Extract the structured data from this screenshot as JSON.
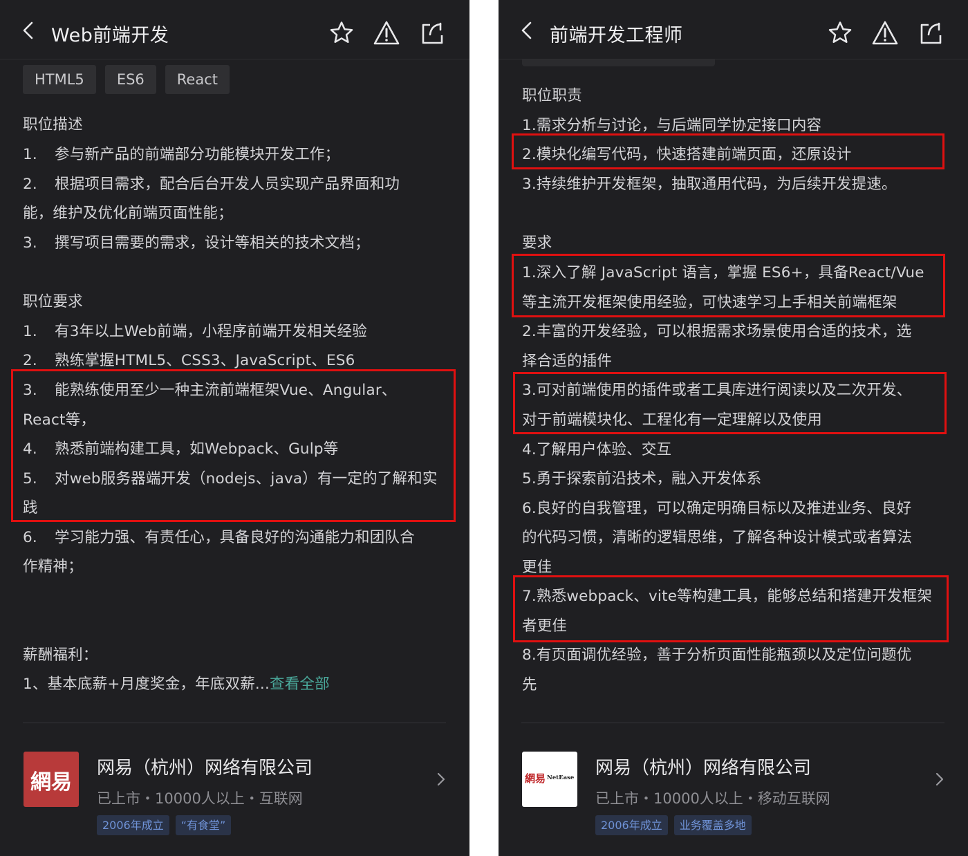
{
  "left": {
    "title": "Web前端开发",
    "chips": [
      "HTML5",
      "ES6",
      "React"
    ],
    "desc_heading": "职位描述",
    "desc_items": [
      {
        "n": "1.",
        "t": "参与新产品的前端部分功能模块开发工作；"
      },
      {
        "n": "2.",
        "t": "根据项目需求，配合后台开发人员实现产品界面和功"
      },
      {
        "n": "",
        "t": "能，维护及优化前端页面性能；"
      },
      {
        "n": "3.",
        "t": "撰写项目需要的需求，设计等相关的技术文档；"
      }
    ],
    "req_heading": "职位要求",
    "req_items": [
      {
        "n": "1.",
        "t": "有3年以上Web前端，小程序前端开发相关经验"
      },
      {
        "n": "2.",
        "t": "熟练掌握HTML5、CSS3、JavaScript、ES6"
      },
      {
        "n": "3.",
        "t": "能熟练使用至少一种主流前端框架Vue、Angular、"
      },
      {
        "n": "",
        "t": "React等，"
      },
      {
        "n": "4.",
        "t": "熟悉前端构建工具，如Webpack、Gulp等"
      },
      {
        "n": "5.",
        "t": "对web服务器端开发（nodejs、java）有一定的了解和实"
      },
      {
        "n": "",
        "t": "践"
      },
      {
        "n": "6.",
        "t": "学习能力强、有责任心，具备良好的沟通能力和团队合"
      },
      {
        "n": "",
        "t": "作精神；"
      }
    ],
    "benefits_heading": "薪酬福利：",
    "benefits_text": "1、基本底薪+月度奖金，年底双薪...",
    "see_all": "查看全部",
    "company": {
      "logo_text": "網易",
      "name": "网易（杭州）网络有限公司",
      "meta": "已上市・10000人以上・互联网",
      "tags": [
        "2006年成立",
        "“有食堂”"
      ]
    }
  },
  "right": {
    "title": "前端开发工程师",
    "duty_heading": "职位职责",
    "duty_items": [
      "1.需求分析与讨论，与后端同学协定接口内容",
      "2.模块化编写代码，快速搭建前端页面，还原设计",
      "3.持续维护开发框架，抽取通用代码，为后续开发提速。"
    ],
    "req_heading": "要求",
    "req_items": [
      "1.深入了解 JavaScript 语言，掌握 ES6+，具备React/Vue",
      "等主流开发框架使用经验，可快速学习上手相关前端框架",
      "2.丰富的开发经验，可以根据需求场景使用合适的技术，选",
      "择合适的插件",
      "3.可对前端使用的插件或者工具库进行阅读以及二次开发、",
      "对于前端模块化、工程化有一定理解以及使用",
      "4.了解用户体验、交互",
      "5.勇于探索前沿技术，融入开发体系",
      "6.良好的自我管理，可以确定明确目标以及推进业务、良好",
      "的代码习惯，清晰的逻辑思维，了解各种设计模式或者算法",
      "更佳",
      "7.熟悉webpack、vite等构建工具，能够总结和搭建开发框架",
      "者更佳",
      "8.有页面调优经验，善于分析页面性能瓶颈以及定位问题优",
      "先"
    ],
    "company": {
      "logo_text": "網易",
      "logo_subtext": "NetEase",
      "name": "网易（杭州）网络有限公司",
      "meta": "已上市・10000人以上・移动互联网",
      "tags": [
        "2006年成立",
        "业务覆盖多地"
      ]
    }
  },
  "colors": {
    "background": "#1f1f22",
    "text": "#d3d3d6",
    "highlight_box": "#e01010",
    "link": "#4aa89a",
    "tag_text": "#6f92d6"
  },
  "icons": [
    "chevron-left-icon",
    "star-icon",
    "warning-icon",
    "share-icon",
    "chevron-right-icon"
  ]
}
